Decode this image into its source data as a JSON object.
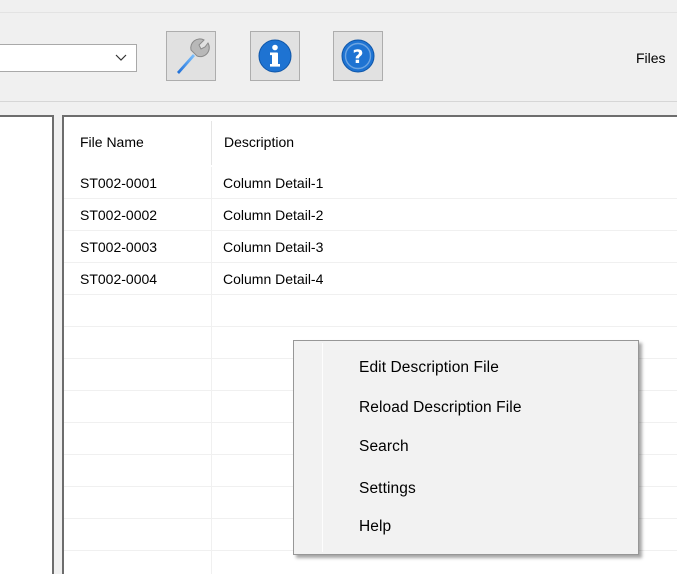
{
  "toolbar": {
    "dropdown_value": "",
    "files_label": "Files",
    "buttons": [
      {
        "icon": "wrench-icon",
        "label": "Settings tool"
      },
      {
        "icon": "info-icon",
        "label": "Info"
      },
      {
        "icon": "help-icon",
        "label": "Help"
      }
    ]
  },
  "list": {
    "columns": [
      "File Name",
      "Description"
    ],
    "rows": [
      {
        "file_name": "ST002-0001",
        "description": "Column Detail-1"
      },
      {
        "file_name": "ST002-0002",
        "description": "Column Detail-2"
      },
      {
        "file_name": "ST002-0003",
        "description": "Column Detail-3"
      },
      {
        "file_name": "ST002-0004",
        "description": "Column Detail-4"
      }
    ]
  },
  "context_menu": {
    "items": [
      "Edit Description File",
      "Reload Description File",
      "Search",
      "Settings",
      "Help"
    ]
  },
  "colors": {
    "accent_blue": "#1e73d2",
    "border_dark": "#6d6d6d",
    "menu_bg": "#f2f2f2"
  }
}
